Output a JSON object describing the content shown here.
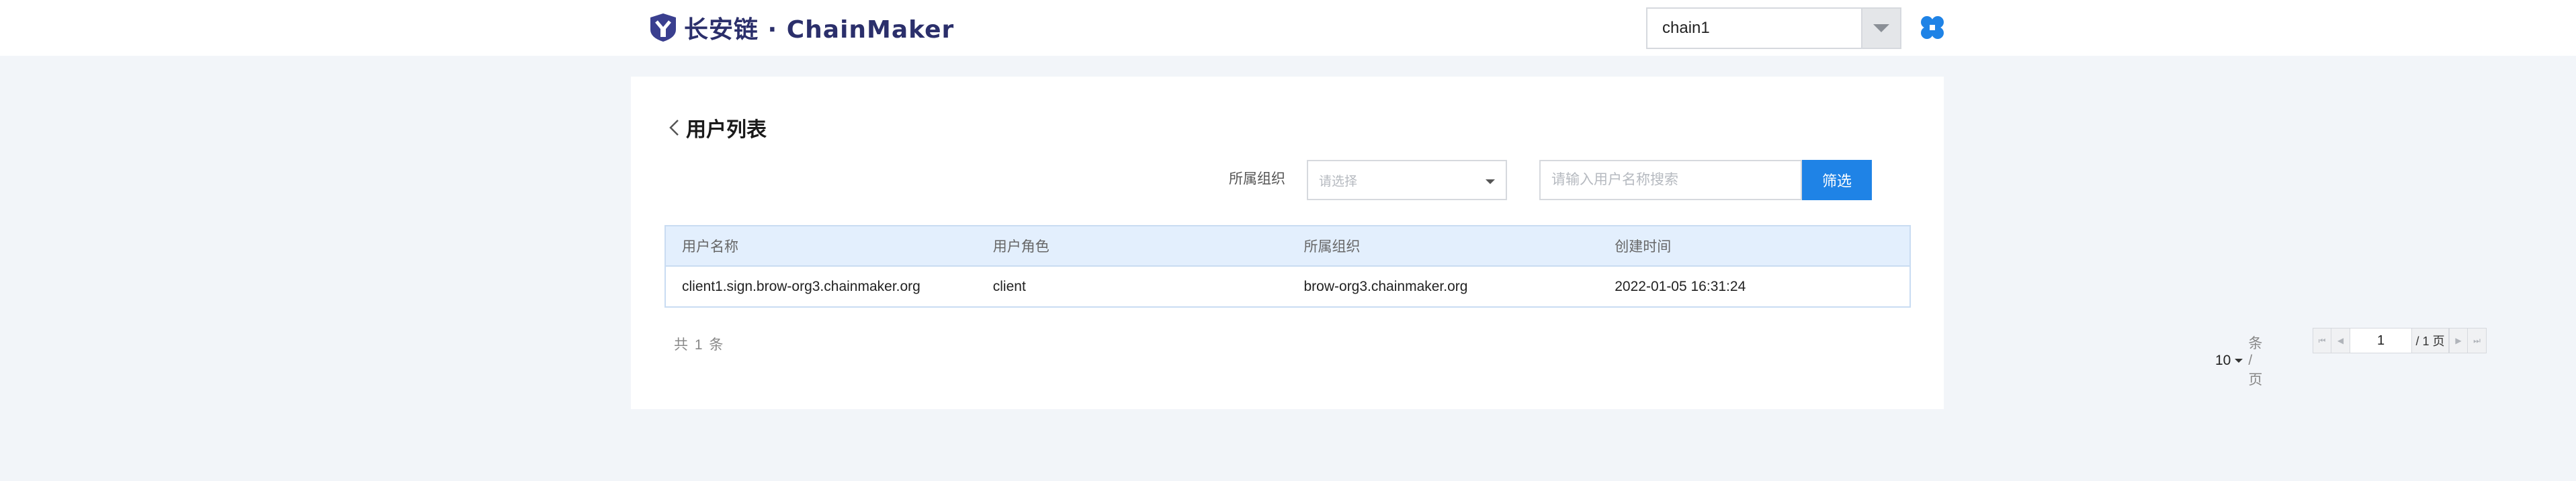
{
  "header": {
    "logo_text": "长安链 · ChainMaker",
    "chain_select": {
      "value": "chain1"
    },
    "app_icon": "four-leaf-icon"
  },
  "page": {
    "title": "用户列表",
    "back_icon": "chevron-left-icon"
  },
  "filters": {
    "org_label": "所属组织",
    "org_placeholder": "请选择",
    "search_placeholder": "请输入用户名称搜索",
    "search_value": "",
    "filter_button": "筛选"
  },
  "table": {
    "columns": [
      "用户名称",
      "用户角色",
      "所属组织",
      "创建时间"
    ],
    "rows": [
      [
        "client1.sign.brow-org3.chainmaker.org",
        "client",
        "brow-org3.chainmaker.org",
        "2022-01-05 16:31:24"
      ]
    ]
  },
  "pagination": {
    "total_text": "共 1 条",
    "page_size": "10",
    "page_size_unit": "条 / 页",
    "current_page": "1",
    "total_pages_text": "/ 1 页"
  },
  "colors": {
    "primary": "#1f83e6",
    "brand_navy": "#2b2f6b",
    "page_bg": "#f2f5f9",
    "table_header_bg": "#e3effd"
  }
}
